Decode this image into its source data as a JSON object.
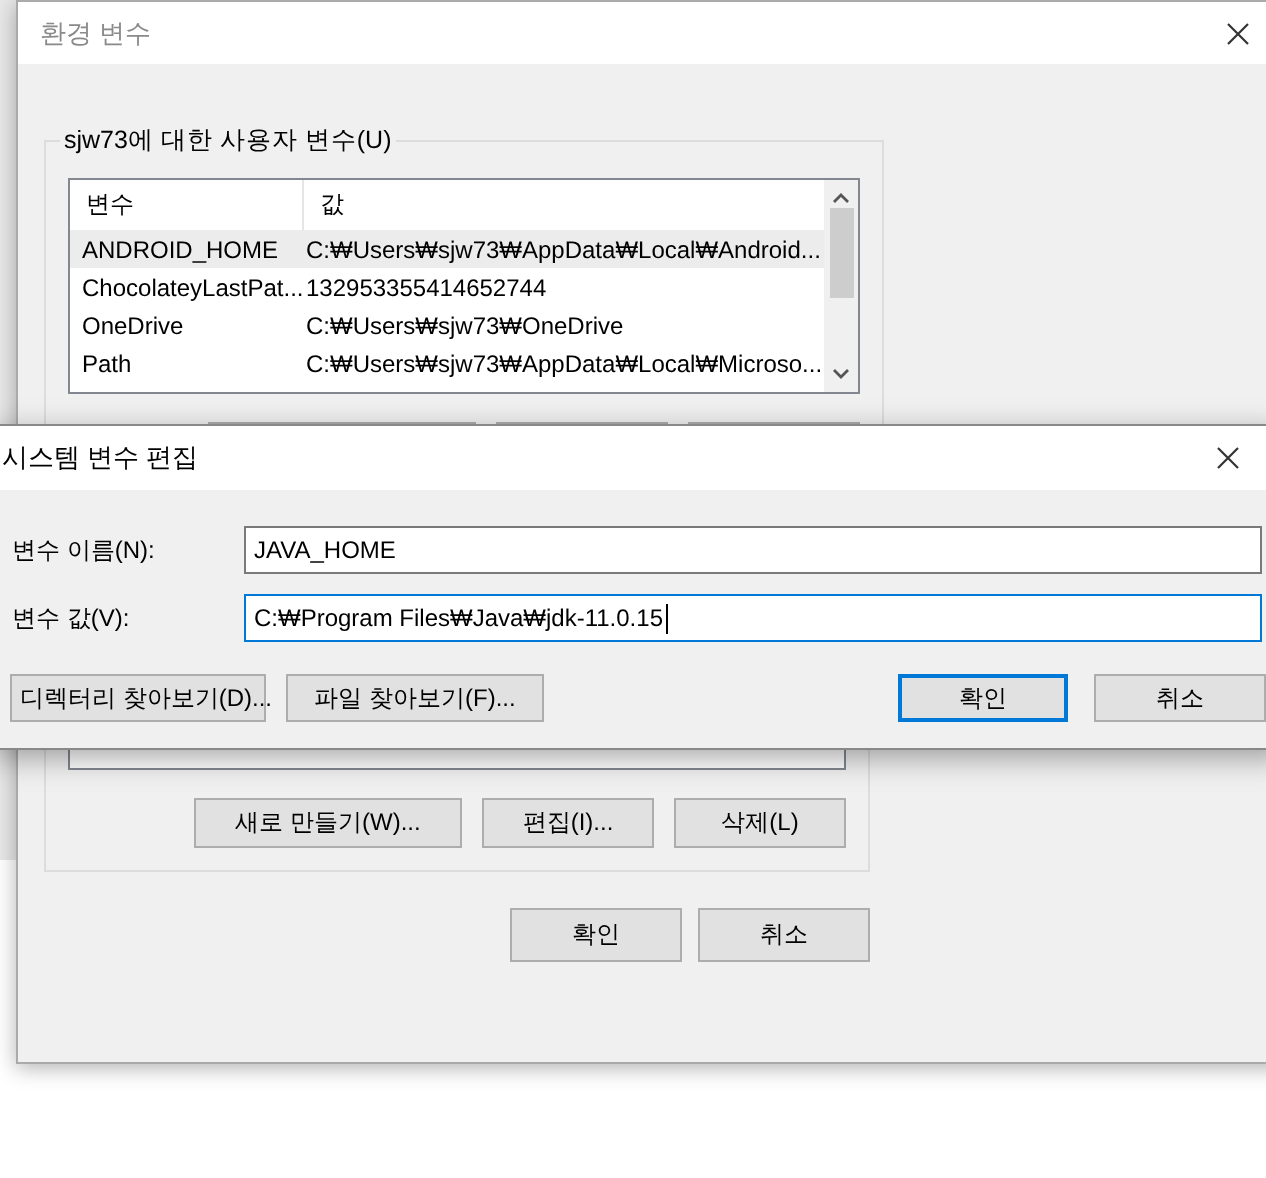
{
  "main_window": {
    "title": "환경 변수",
    "user_group": {
      "legend": "sjw73에 대한 사용자 변수(U)",
      "columns": [
        "변수",
        "값"
      ],
      "rows": [
        {
          "name": "ANDROID_HOME",
          "value": "C:₩Users₩sjw73₩AppData₩Local₩Android...",
          "selected": true
        },
        {
          "name": "ChocolateyLastPat...",
          "value": "132953355414652744",
          "selected": false
        },
        {
          "name": "OneDrive",
          "value": "C:₩Users₩sjw73₩OneDrive",
          "selected": false
        },
        {
          "name": "Path",
          "value": "C:₩Users₩sjw73₩AppData₩Local₩Microso...",
          "selected": false
        }
      ]
    },
    "system_group": {
      "buttons": [
        "새로 만들기(W)...",
        "편집(I)...",
        "삭제(L)"
      ]
    },
    "buttons": [
      "확인",
      "취소"
    ]
  },
  "edit_dialog": {
    "title": "시스템 변수 편집",
    "fields": [
      {
        "label": "변수 이름(N):",
        "value": "JAVA_HOME",
        "focused": false
      },
      {
        "label": "변수 값(V):",
        "value": "C:₩Program Files₩Java₩jdk-11.0.15",
        "focused": true
      }
    ],
    "buttons": [
      {
        "label": "디렉터리 찾아보기(D)...",
        "default": false
      },
      {
        "label": "파일 찾아보기(F)...",
        "default": false
      },
      {
        "label": "확인",
        "default": true
      },
      {
        "label": "취소",
        "default": false
      }
    ]
  }
}
